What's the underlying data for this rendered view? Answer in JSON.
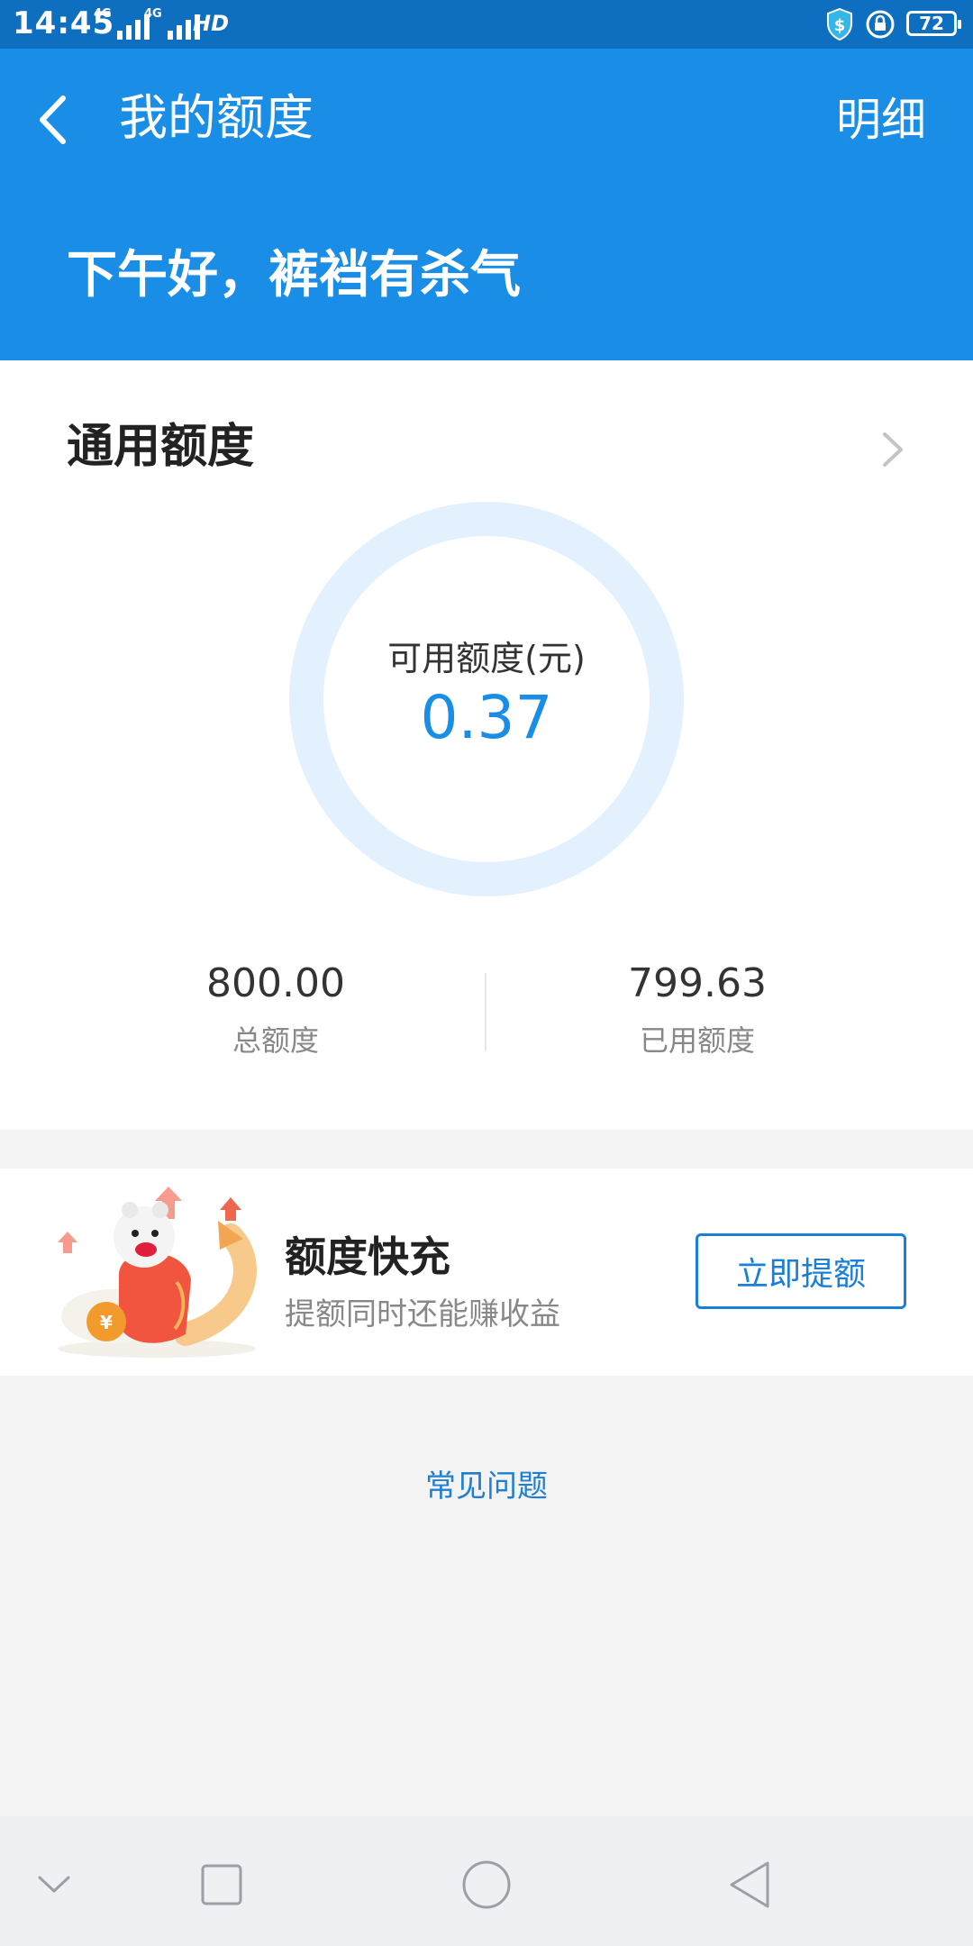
{
  "status_bar": {
    "time": "14:45",
    "signal1_tag": "4G",
    "signal2_tag": "4G",
    "network_badge": "HD",
    "battery": "72"
  },
  "header": {
    "title": "我的额度",
    "detail_link": "明细",
    "greeting": "下午好，裤裆有杀气",
    "background_color": "#1a8ee6"
  },
  "credit": {
    "section_title": "通用额度",
    "available_label": "可用额度(元)",
    "available_value": "0.37",
    "total_value": "800.00",
    "total_label": "总额度",
    "used_value": "799.63",
    "used_label": "已用额度",
    "accent_color": "#1a8ee6",
    "ring_color": "#e2f1fd"
  },
  "boost": {
    "title": "额度快充",
    "subtitle": "提额同时还能赚收益",
    "button_label": "立即提额"
  },
  "faq": {
    "link_label": "常见问题"
  },
  "nav_bar": {
    "icons": [
      "chevron-down-icon",
      "recent-apps-icon",
      "home-icon",
      "back-icon"
    ]
  }
}
